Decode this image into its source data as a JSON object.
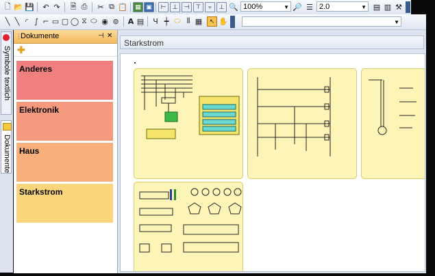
{
  "toolbar1": {
    "zoom_value": "100%",
    "line_width_value": "2.0"
  },
  "side_tabs": {
    "symbols": "Symbole textlich",
    "documents": "Dokumente"
  },
  "documents_panel": {
    "title": "Dokumente",
    "items": [
      {
        "label": "Anderes",
        "color": "#f08080"
      },
      {
        "label": "Elektronik",
        "color": "#f59a7e"
      },
      {
        "label": "Haus",
        "color": "#f7b07c"
      },
      {
        "label": "Starkstrom",
        "color": "#fad57c"
      }
    ]
  },
  "main": {
    "document_title": "Starkstrom"
  }
}
